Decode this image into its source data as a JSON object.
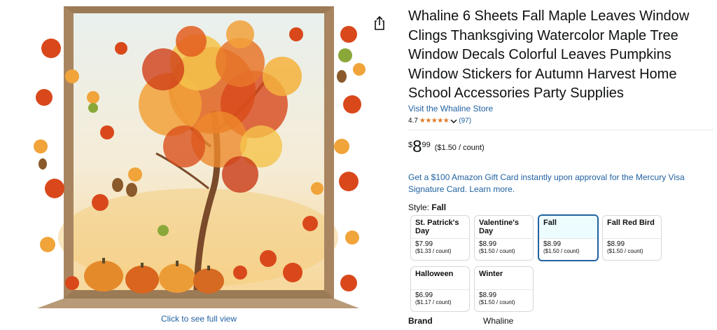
{
  "gallery": {
    "image_alt": "Fall maple tree window clings",
    "full_view_link": "Click to see full view"
  },
  "share": {
    "icon": "share-icon"
  },
  "product": {
    "title": "Whaline 6 Sheets Fall Maple Leaves Window Clings Thanksgiving Watercolor Maple Tree Window Decals Colorful Leaves Pumpkins Window Stickers for Autumn Harvest Home School Accessories Party Supplies",
    "store_link": "Visit the Whaline Store",
    "rating": {
      "value": "4.7",
      "stars": "★★★★★",
      "count": "(97)"
    },
    "price": {
      "symbol": "$",
      "whole": "8",
      "fraction": "99",
      "per_unit": "($1.50 / count)"
    },
    "promo": "Get a $100 Amazon Gift Card instantly upon approval for the Mercury Visa Signature Card. Learn more.",
    "style": {
      "label": "Style:",
      "selected": "Fall",
      "options": [
        {
          "name": "St. Patrick's Day",
          "price": "$7.99",
          "unit": "($1.33 / count)"
        },
        {
          "name": "Valentine's Day",
          "price": "$8.99",
          "unit": "($1.50 / count)"
        },
        {
          "name": "Fall",
          "price": "$8.99",
          "unit": "($1.50 / count)"
        },
        {
          "name": "Fall Red Bird",
          "price": "$8.99",
          "unit": "($1.50 / count)"
        },
        {
          "name": "Halloween",
          "price": "$6.99",
          "unit": "($1.17 / count)"
        },
        {
          "name": "Winter",
          "price": "$8.99",
          "unit": "($1.50 / count)"
        }
      ]
    },
    "details": {
      "brand_label": "Brand",
      "brand_value": "Whaline"
    }
  },
  "colors": {
    "link": "#2162A1",
    "star": "#DE7921",
    "selected_border": "#2162A1",
    "selected_bg": "#EDFDFF"
  }
}
